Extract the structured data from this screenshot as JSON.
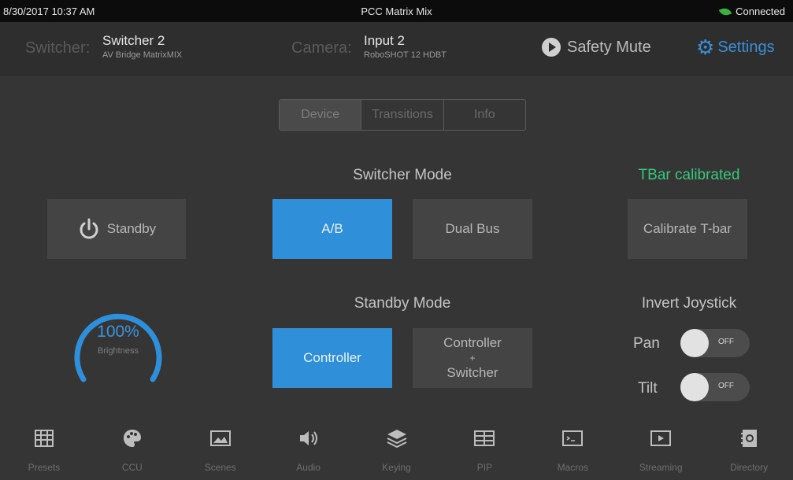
{
  "status_bar": {
    "datetime": "8/30/2017 10:37 AM",
    "title": "PCC Matrix Mix",
    "connection": "Connected"
  },
  "header": {
    "switcher_label": "Switcher:",
    "switcher_name": "Switcher 2",
    "switcher_device": "AV Bridge MatrixMIX",
    "camera_label": "Camera:",
    "camera_name": "Input 2",
    "camera_device": "RoboSHOT 12 HDBT",
    "safety_mute": "Safety Mute",
    "settings": "Settings"
  },
  "tabs": [
    {
      "label": "Device",
      "active": true
    },
    {
      "label": "Transitions",
      "active": false
    },
    {
      "label": "Info",
      "active": false
    }
  ],
  "left": {
    "standby_button": "Standby",
    "brightness_value": "100%",
    "brightness_fraction": 1.0,
    "brightness_label": "Brightness"
  },
  "switcher_mode": {
    "title": "Switcher Mode",
    "options": [
      "A/B",
      "Dual Bus"
    ],
    "selected": "A/B"
  },
  "standby_mode": {
    "title": "Standby Mode",
    "options": [
      "Controller",
      "Controller",
      "+",
      "Switcher"
    ],
    "selected": "Controller"
  },
  "right": {
    "tbar_status": "TBar calibrated",
    "calibrate_button": "Calibrate T-bar",
    "invert_title": "Invert Joystick",
    "pan_label": "Pan",
    "pan_state": "OFF",
    "tilt_label": "Tilt",
    "tilt_state": "OFF"
  },
  "nav": [
    "Presets",
    "CCU",
    "Scenes",
    "Audio",
    "Keying",
    "PIP",
    "Macros",
    "Streaming",
    "Directory"
  ],
  "colors": {
    "accent": "#2f8fd8",
    "success": "#39c77a",
    "background": "#353535"
  }
}
